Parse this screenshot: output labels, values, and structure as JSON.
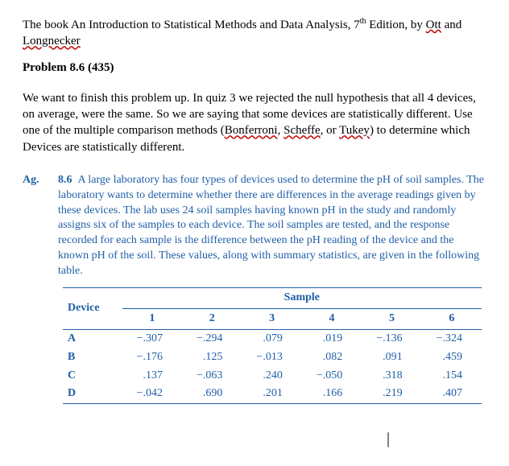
{
  "intro": {
    "prefix": "The book An Introduction to Statistical Methods and Data Analysis, 7",
    "sup": "th",
    "middle": " Edition, by ",
    "author1": "Ott",
    "and": " and ",
    "author2": "Longnecker"
  },
  "problem_title": "Problem 8.6 (435)",
  "paragraph_pre": "We want to finish this problem up.  In quiz 3 we rejected the null hypothesis that all 4 devices, on average, were the same.  So we are saying that some devices are statistically different.  Use one of the multiple comparison methods (",
  "method1": "Bonferroni",
  "comma1": ", ",
  "method2": "Scheffe",
  "comma2": ", or ",
  "method3": "Tukey",
  "paragraph_post": ") to determine which Devices are statistically different.",
  "ag_label": "Ag.",
  "exercise_num": "8.6",
  "exercise_text": "A large laboratory has four types of devices used to determine the pH of soil samples. The laboratory wants to determine whether there are differences in the average readings given by these devices. The lab uses 24 soil samples having known pH in the study and randomly assigns six of the samples to each device. The soil samples are tested, and the response recorded for each sample is the difference between the pH reading of the device and the known pH of the soil. These values, along with summary statistics, are given in the following table.",
  "table": {
    "sample_label": "Sample",
    "device_label": "Device",
    "cols": [
      "1",
      "2",
      "3",
      "4",
      "5",
      "6"
    ],
    "rows": [
      {
        "device": "A",
        "vals": [
          "−.307",
          "−.294",
          ".079",
          ".019",
          "−.136",
          "−.324"
        ]
      },
      {
        "device": "B",
        "vals": [
          "−.176",
          ".125",
          "−.013",
          ".082",
          ".091",
          ".459"
        ]
      },
      {
        "device": "C",
        "vals": [
          ".137",
          "−.063",
          ".240",
          "−.050",
          ".318",
          ".154"
        ]
      },
      {
        "device": "D",
        "vals": [
          "−.042",
          ".690",
          ".201",
          ".166",
          ".219",
          ".407"
        ]
      }
    ]
  },
  "cursor": "|",
  "chart_data": {
    "type": "table",
    "title": "pH reading difference by Device and Sample",
    "row_label": "Device",
    "col_label": "Sample",
    "columns": [
      "1",
      "2",
      "3",
      "4",
      "5",
      "6"
    ],
    "series": [
      {
        "name": "A",
        "values": [
          -0.307,
          -0.294,
          0.079,
          0.019,
          -0.136,
          -0.324
        ]
      },
      {
        "name": "B",
        "values": [
          -0.176,
          0.125,
          -0.013,
          0.082,
          0.091,
          0.459
        ]
      },
      {
        "name": "C",
        "values": [
          0.137,
          -0.063,
          0.24,
          -0.05,
          0.318,
          0.154
        ]
      },
      {
        "name": "D",
        "values": [
          -0.042,
          0.69,
          0.201,
          0.166,
          0.219,
          0.407
        ]
      }
    ]
  }
}
